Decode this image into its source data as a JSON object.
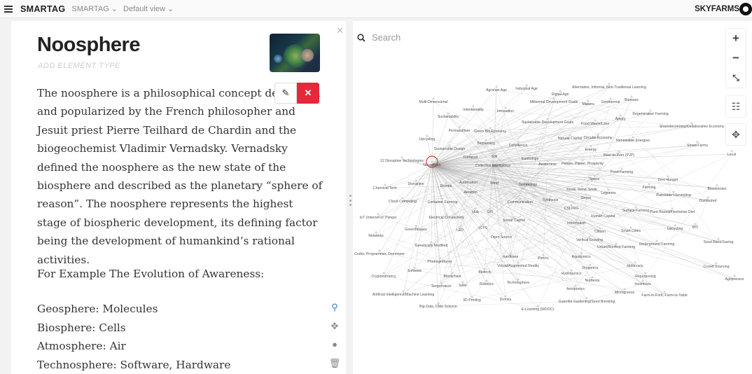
{
  "topbar": {
    "brand": "SMARTAG",
    "crumb1": "SMARTAG ⌄",
    "crumb2": "Default view ⌄",
    "org": "SKYFARMS"
  },
  "element": {
    "title": "Noosphere",
    "type_placeholder": "ADD ELEMENT TYPE",
    "description": "The noosphere is a philosophical concept developed and popularized by the French philosopher and Jesuit priest Pierre Teilhard de Chardin and the biogeochemist Vladimir Vernadsky. Vernadsky defined the noosphere as the new state of the biosphere and described as the planetary “sphere of reason”. The noosphere represents the highest stage of biospheric development, its defining factor being the development of humankind’s rational activities.",
    "example_heading": "For Example The Evolution of Awareness:",
    "list": [
      "Geosphere: Molecules",
      "Biosphere: Cells",
      "Atmosphere: Air",
      "Technosphere: Software, Hardware"
    ]
  },
  "buttons": {
    "edit_icon": "pencil-icon",
    "delete_icon": "close-icon"
  },
  "search": {
    "placeholder": "Search"
  },
  "colors": {
    "delete": "#e6283a",
    "pin": "#2f7fd0"
  },
  "graph": {
    "nodes": [
      "Agrarian Age",
      "Industrial Age",
      "Digital Age",
      "Alternative, Informal, Non-Traditional Learning",
      "Biomass",
      "Multi-Dimensional",
      "Millennial Development Goals",
      "Makers",
      "Geothermal",
      "Intentionality",
      "Innovation",
      "Regenerative Farming",
      "Sustainability",
      "Sustainable Development Goals",
      "Food Waste/Loss",
      "Apiary",
      "Sharedeconomy/Collaborative Economy",
      "Permaculture",
      "Green Bio Economy",
      "Upcycling",
      "Biomimicry",
      "Natural Capital",
      "Circular Economy",
      "Renewable Energies",
      "Smart Farms",
      "Sustainable Design",
      "Consilience",
      "Energy",
      "Peer-to-Peer (P2P)",
      "Local",
      "Compost",
      "Soil",
      "Earthships",
      "12 Disruptive Technologies",
      "Noosphere",
      "Collective Intelligence",
      "Awareness",
      "People, Planet, Prosperity",
      "Food Farming",
      "Space",
      "Zero Hunger",
      "Automation",
      "Wind",
      "Disruptive",
      "Drones",
      "Aeration",
      "Technology",
      "Know, Grow, Smile",
      "Legumes",
      "Farming",
      "Biocentrism",
      "Chemical Tech",
      "Grows",
      "Rainwater Harvesting",
      "Cloud Computing",
      "Container Farming",
      "Communication",
      "Synthesis",
      "Distributed",
      "Hub",
      "GIS",
      "CSL/IRG",
      "Surface Farming",
      "Plant-Based/Flexitarian Diet",
      "IoT (Internet of Things)",
      "Electrical Conductivity",
      "Human Capital",
      "Information",
      "Social Capital",
      "Greenhouses",
      "LED",
      "ICTS",
      "Citizen",
      "Smart Cities",
      "Upcycling",
      "DIY",
      "Networks",
      "Open Source",
      "Vertical Growing",
      "Urban/Rooftop Farming",
      "Underground Farming",
      "Seed Bank/Saving",
      "Genetically Modified",
      "Coder, Programmer, Developer",
      "Hardware",
      "Ponics",
      "Aquaponics",
      "Photosynthesis",
      "Virtual/Augmented Reality",
      "Hydroponics",
      "Holocracy",
      "Crowd Sourcing",
      "Software",
      "Blockchain",
      "Biotech",
      "Dryponics",
      "Cryptocurrency",
      "Robotics",
      "Technosphere",
      "Nutrients",
      "Repurposing",
      "Agripreneur",
      "Temperature",
      "Solar",
      "Incentives",
      "Artificial Intelligence/Machine Learning",
      "Aeroponics",
      "Microgreens",
      "Farm-to-Fork, Farm-to-Table",
      "3D Printing",
      "Drones",
      "Guerrilla Gardening/Seed Bombing",
      "Big Data, Data Science",
      "E-Learning (MOOC)"
    ]
  }
}
